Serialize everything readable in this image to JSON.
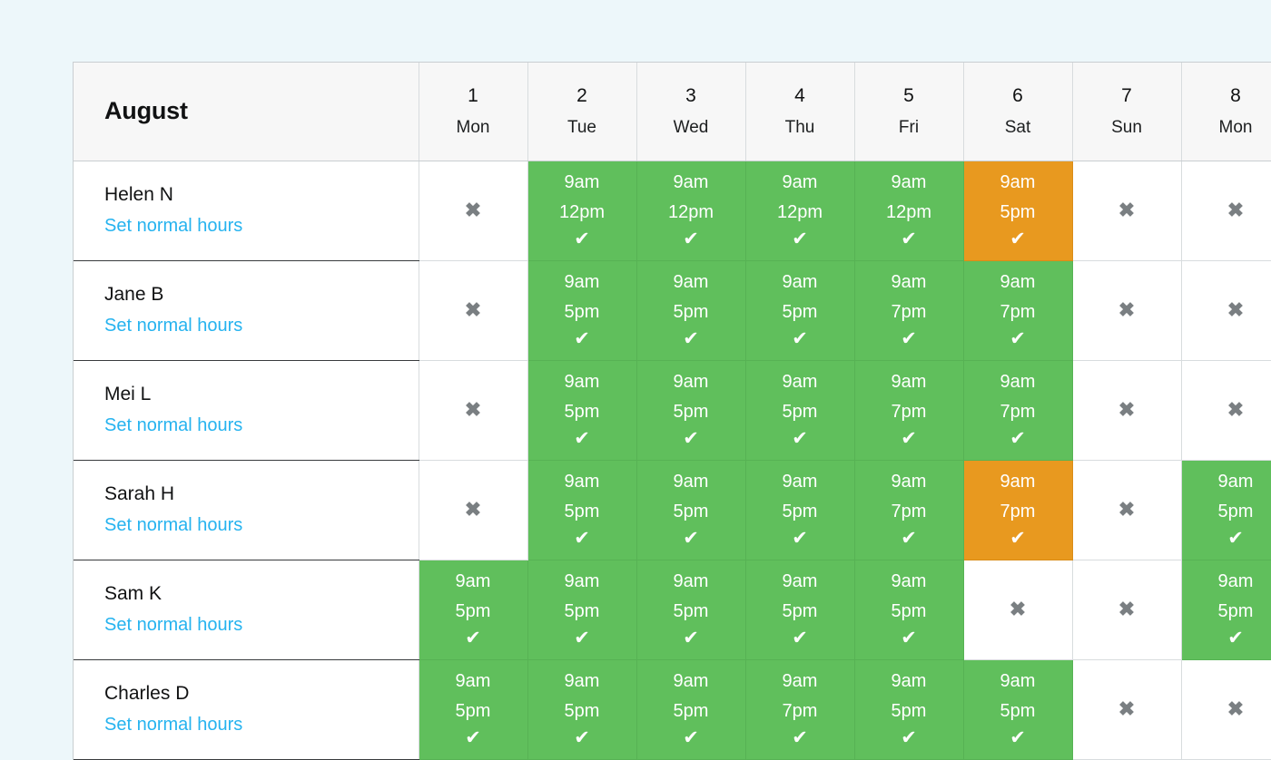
{
  "page": {
    "background_color": "#edf7fa"
  },
  "rota": {
    "month_label": "August",
    "colors": {
      "shift_on": "#60bf5c",
      "shift_alt": "#e8991f",
      "link": "#26b3ef",
      "off_mark": "#7a7f82",
      "header_bg": "#f7f7f7"
    },
    "icons": {
      "tick": "✔",
      "cross": "✖"
    },
    "days": [
      {
        "num": "1",
        "name": "Mon"
      },
      {
        "num": "2",
        "name": "Tue"
      },
      {
        "num": "3",
        "name": "Wed"
      },
      {
        "num": "4",
        "name": "Thu"
      },
      {
        "num": "5",
        "name": "Fri"
      },
      {
        "num": "6",
        "name": "Sat"
      },
      {
        "num": "7",
        "name": "Sun"
      },
      {
        "num": "8",
        "name": "Mon"
      }
    ],
    "set_hours_label": "Set normal hours",
    "staff": [
      {
        "name": "Helen N",
        "link": "Set normal hours",
        "shifts": [
          {
            "state": "off"
          },
          {
            "state": "on",
            "start": "9am",
            "end": "12pm"
          },
          {
            "state": "on",
            "start": "9am",
            "end": "12pm"
          },
          {
            "state": "on",
            "start": "9am",
            "end": "12pm"
          },
          {
            "state": "on",
            "start": "9am",
            "end": "12pm"
          },
          {
            "state": "alt",
            "start": "9am",
            "end": "5pm"
          },
          {
            "state": "off"
          },
          {
            "state": "off"
          }
        ]
      },
      {
        "name": "Jane B",
        "link": "Set normal hours",
        "shifts": [
          {
            "state": "off"
          },
          {
            "state": "on",
            "start": "9am",
            "end": "5pm"
          },
          {
            "state": "on",
            "start": "9am",
            "end": "5pm"
          },
          {
            "state": "on",
            "start": "9am",
            "end": "5pm"
          },
          {
            "state": "on",
            "start": "9am",
            "end": "7pm"
          },
          {
            "state": "on",
            "start": "9am",
            "end": "7pm"
          },
          {
            "state": "off"
          },
          {
            "state": "off"
          }
        ]
      },
      {
        "name": "Mei L",
        "link": "Set normal hours",
        "shifts": [
          {
            "state": "off"
          },
          {
            "state": "on",
            "start": "9am",
            "end": "5pm"
          },
          {
            "state": "on",
            "start": "9am",
            "end": "5pm"
          },
          {
            "state": "on",
            "start": "9am",
            "end": "5pm"
          },
          {
            "state": "on",
            "start": "9am",
            "end": "7pm"
          },
          {
            "state": "on",
            "start": "9am",
            "end": "7pm"
          },
          {
            "state": "off"
          },
          {
            "state": "off"
          }
        ]
      },
      {
        "name": "Sarah H",
        "link": "Set normal hours",
        "shifts": [
          {
            "state": "off"
          },
          {
            "state": "on",
            "start": "9am",
            "end": "5pm"
          },
          {
            "state": "on",
            "start": "9am",
            "end": "5pm"
          },
          {
            "state": "on",
            "start": "9am",
            "end": "5pm"
          },
          {
            "state": "on",
            "start": "9am",
            "end": "7pm"
          },
          {
            "state": "alt",
            "start": "9am",
            "end": "7pm"
          },
          {
            "state": "off"
          },
          {
            "state": "on",
            "start": "9am",
            "end": "5pm"
          }
        ]
      },
      {
        "name": "Sam K",
        "link": "Set normal hours",
        "shifts": [
          {
            "state": "on",
            "start": "9am",
            "end": "5pm"
          },
          {
            "state": "on",
            "start": "9am",
            "end": "5pm"
          },
          {
            "state": "on",
            "start": "9am",
            "end": "5pm"
          },
          {
            "state": "on",
            "start": "9am",
            "end": "5pm"
          },
          {
            "state": "on",
            "start": "9am",
            "end": "5pm"
          },
          {
            "state": "off"
          },
          {
            "state": "off"
          },
          {
            "state": "on",
            "start": "9am",
            "end": "5pm"
          }
        ]
      },
      {
        "name": "Charles D",
        "link": "Set normal hours",
        "shifts": [
          {
            "state": "on",
            "start": "9am",
            "end": "5pm"
          },
          {
            "state": "on",
            "start": "9am",
            "end": "5pm"
          },
          {
            "state": "on",
            "start": "9am",
            "end": "5pm"
          },
          {
            "state": "on",
            "start": "9am",
            "end": "7pm"
          },
          {
            "state": "on",
            "start": "9am",
            "end": "5pm"
          },
          {
            "state": "on",
            "start": "9am",
            "end": "5pm"
          },
          {
            "state": "off"
          },
          {
            "state": "off"
          }
        ]
      }
    ]
  }
}
